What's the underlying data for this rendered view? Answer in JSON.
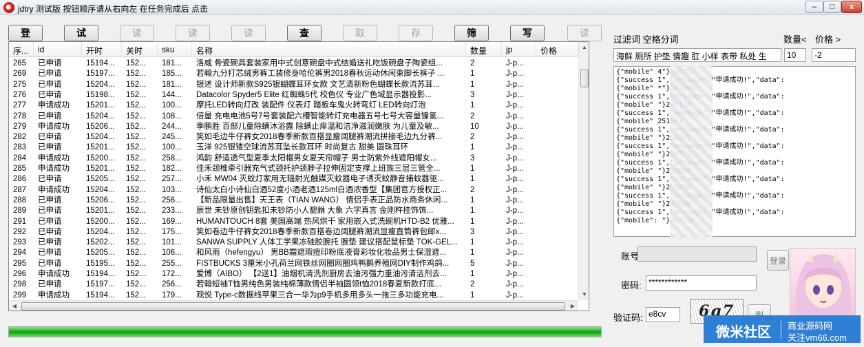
{
  "window": {
    "title": "jdtry  测试版 按钮顺序请从右向左 在任务完成后 点击",
    "min_label": "–",
    "max_label": "□",
    "close_label": "x"
  },
  "toolbar": [
    {
      "label": "登",
      "enabled": true
    },
    {
      "label": "试",
      "enabled": true
    },
    {
      "label": "读",
      "enabled": false
    },
    {
      "label": "读",
      "enabled": false
    },
    {
      "label": "读",
      "enabled": false
    },
    {
      "label": "查",
      "enabled": true
    },
    {
      "label": "取",
      "enabled": false
    },
    {
      "label": "存",
      "enabled": false
    },
    {
      "label": "筛",
      "enabled": true
    },
    {
      "label": "写",
      "enabled": true
    },
    {
      "label": "读",
      "enabled": false
    }
  ],
  "grid": {
    "columns": [
      "序...",
      "id",
      "开时",
      "关时",
      "sku",
      "名称",
      "数量",
      "jp",
      "价格"
    ],
    "rows": [
      [
        "265",
        "已申请",
        "15194...",
        "152...",
        "181...",
        "洛威 骨瓷碗具套装家用中式创意碗盘中式结婚送礼吃饭碗盘子陶瓷组...",
        "2",
        "J-p...",
        ""
      ],
      [
        "269",
        "已申请",
        "15197...",
        "152...",
        "185...",
        "若翰九分打芯绒男裤工装修身哈伦裤男2018春秋运动休闲束脚长裤子 ...",
        "1",
        "J-p...",
        ""
      ],
      [
        "275",
        "已申请",
        "15204...",
        "152...",
        "181...",
        "银述 设计师新款S925银蝴蝶耳环女款 文艺清新粉色蝴蝶长款流苏耳...",
        "1",
        "J-p...",
        ""
      ],
      [
        "276",
        "已申请",
        "15198...",
        "152...",
        "144...",
        "Datacolor Spyder5 Elite 红蜘蛛5代 校色仪 专业广色域显示器投影...",
        "3",
        "J-p...",
        ""
      ],
      [
        "277",
        "申请成功",
        "15201...",
        "152...",
        "100...",
        "摩托LED转向灯改 装配件 仪表灯 踏板车鬼火转弯灯 LED转向灯泡",
        "1",
        "J-p...",
        ""
      ],
      [
        "278",
        "已申请",
        "15204...",
        "152...",
        "108...",
        "倍量 充电电池5号7号套装配六槽智能转灯充电器五号七号大容量镍氢...",
        "2",
        "J-p...",
        ""
      ],
      [
        "279",
        "申请成功",
        "15206...",
        "152...",
        "244...",
        "季鹏胜 百部儿童除螨沐浴露 除螨止痒温和洁净滋润嫩肤 为儿童及敏...",
        "10",
        "J-p...",
        ""
      ],
      [
        "282",
        "已申请",
        "15204...",
        "152...",
        "245...",
        "笑如毛边牛仔裤女2018春季新款百搭显瘦阔腿裤潮流拼接毛边九分裤...",
        "2",
        "J-p...",
        ""
      ],
      [
        "283",
        "已申请",
        "15201...",
        "152...",
        "100...",
        "玉洋    925银镂空球流苏耳坠长款耳环 时尚复古 甜美 圆珠耳环",
        "1",
        "J-p...",
        ""
      ],
      [
        "284",
        "申请成功",
        "15200...",
        "152...",
        "258...",
        "鸿韵 舒适透气型夏季太阳帽男女夏天帘帽子 男士防紫外线遮阳帽女...",
        "3",
        "J-p...",
        ""
      ],
      [
        "285",
        "申请成功",
        "15201...",
        "152...",
        "182...",
        "佳禾颈椎牵引器充气式颈托护颈脖子拉伸固定支撑上班族三层三管全...",
        "1",
        "J-p...",
        ""
      ],
      [
        "286",
        "已申请",
        "15205...",
        "152...",
        "257...",
        "小禾 MW04 灭蚊灯家用无辐射光触媒灭蚊器电子诱灭蚊静音捕蚊器驱...",
        "1",
        "J-p...",
        ""
      ],
      [
        "287",
        "申请成功",
        "15204...",
        "152...",
        "103...",
        "诗仙太白小诗仙白酒52度小酒老酒125ml白酒浓香型【集团官方授权正...",
        "2",
        "J-p...",
        ""
      ],
      [
        "288",
        "已申请",
        "15206...",
        "152...",
        "256...",
        "【新品限量出售】天王表（TIAN WANG） 情侣手表正品防水商务休闲...",
        "1",
        "J-p...",
        ""
      ],
      [
        "289",
        "已申请",
        "15201...",
        "152...",
        "233...",
        "辰世 未钞原创钥匙扣未钞防小人貔貅 大象 六字真言 金刚杵挂饰饰...",
        "1",
        "J-p...",
        ""
      ],
      [
        "291",
        "已申请",
        "15200...",
        "152...",
        "169...",
        "HUMANTOUCH 8套 美国高端 热风烘干 家用嵌入式洗碗机HTD-B2 优雅...",
        "1",
        "J-p...",
        ""
      ],
      [
        "292",
        "已申请",
        "15204...",
        "152...",
        "175...",
        "笑如卷边牛仔裤女2018春季新款百搭卷边阔腿裤潮流显瘦直筒裤包邮x...",
        "3",
        "J-p...",
        ""
      ],
      [
        "293",
        "已申请",
        "15202...",
        "152...",
        "101...",
        "SANWA SUPPLY 人体工学果冻硅胶腕托 腕垫 建议搭配鼠标垫 TOK-GEL...",
        "1",
        "J-p...",
        ""
      ],
      [
        "294",
        "已申请",
        "15205...",
        "152...",
        "106...",
        "和风雨（hefengyu） 男BB霜遮瑕痘印粉底液膏彩妆化妆品男士保湿遮...",
        "1",
        "J-p...",
        ""
      ],
      [
        "295",
        "已申请",
        "15195...",
        "152...",
        "255...",
        "FISTBUCKS 3厘米小孔荷兰网铁丝网圈网圈鸡鸭鹅养殖网DIY制作鸡鸽...",
        "5",
        "J-p...",
        ""
      ],
      [
        "296",
        "申请成功",
        "15194...",
        "152...",
        "172...",
        "爱博（AIBO） 【2送1】油烟机清洗剂厨房去油污强力重油污清洁剂去...",
        "1",
        "J-p...",
        ""
      ],
      [
        "298",
        "已申请",
        "15197...",
        "152...",
        "256...",
        "若翰短袖T恤男纯色男装纯棉薄款情侣半袖圆领t恤2018春夏新款打底...",
        "2",
        "J-p...",
        ""
      ],
      [
        "299",
        "申请成功",
        "15194...",
        "152...",
        "179...",
        "观悦 Type-c数据线苹果三合一华为p9手机多用多头一拖三多功能充电...",
        "1",
        "J-p...",
        ""
      ]
    ]
  },
  "progress": {
    "value": 1.0,
    "color": "#17b317"
  },
  "filter": {
    "label": "过滤词 空格分词",
    "qty_label": "数量<",
    "price_label": "价格 >",
    "words": "海鲜 厕所 护垫 情趣 肛 小样 表带 私处 生",
    "qty_value": "10",
    "price_value": "-2"
  },
  "log": [
    "{\"mobile\"                4\"}248752",
    "{\"success                 1\",\"message\":\"申请成功!\",\"data\":",
    "{\"mobile\"              *\"}247496",
    "{\"success                 1\",\"message\":\"申请成功!\",\"data\":",
    "{\"mobile\"                \"}247118",
    "{\"success                 1\",\"message\":\"申请成功!\",\"data\":",
    "{\"mobile\"                 251061",
    "{\"success                 1\",\"message\":\"申请成功!\",\"data\":",
    "{\"mobile\"                \"}251241",
    "{\"success                 1\",\"message\":\"申请成功!\",\"data\":",
    "{\"mobile\"                \"}250759",
    "{\"success                 1\",\"message\":\"申请成功!\",\"data\":",
    "{\"mobile\"                \"}253600",
    "{\"success                 1\",\"message\":\"申请成功!\",\"data\":",
    "{\"mobile\"                \"}253886",
    "{\"success                 1\",\"message\":\"申请成功!\",\"data\":",
    "{\"mobile\"                \"}247526",
    "{\"success                 1\",\"message\":\"申请成功!\",\"data\":",
    "{\"mobile\":              \"}247230"
  ],
  "login": {
    "account_label": "账号",
    "account_value": "",
    "password_label": "密码:",
    "password_value": "************",
    "captcha_label": "验证码:",
    "captcha_value": "e8cv",
    "captcha_image_text": "6q7",
    "login_button": "登录",
    "small_button": "刷"
  },
  "watermark": {
    "main": "微米社区",
    "top": "商业源码网",
    "bottom": "关注vm66.com"
  }
}
